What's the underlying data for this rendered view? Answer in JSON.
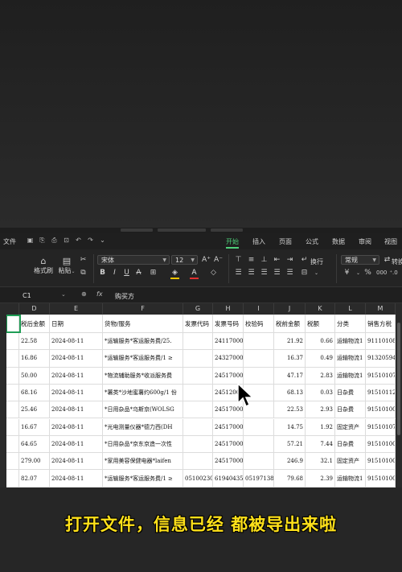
{
  "menu": {
    "file": "文件",
    "tabs": [
      "开始",
      "插入",
      "页面",
      "公式",
      "数据",
      "审阅",
      "视图"
    ],
    "active_tab": "开始"
  },
  "ribbon": {
    "format_painter": "格式刷",
    "paste": "粘贴",
    "font_name": "宋体",
    "font_size": "12",
    "wrap": "换行",
    "number_format": "常规",
    "convert": "转换"
  },
  "formula_bar": {
    "cell_ref": "C1",
    "fx": "fx",
    "content": "购买方"
  },
  "columns": [
    "D",
    "E",
    "F",
    "G",
    "H",
    "I",
    "J",
    "K",
    "L",
    "M"
  ],
  "header_row": [
    "税后金额",
    "日期",
    "货物/服务",
    "发票代码",
    "发票号码",
    "校验码",
    "税前金额",
    "税额",
    "分类",
    "销售方税"
  ],
  "rows": [
    [
      "22.58",
      "2024-08-11",
      "*运输服务*客运服务费/25.",
      "",
      "241170000",
      "",
      "21.92",
      "0.66",
      "运输物流1",
      "91110108M"
    ],
    [
      "16.86",
      "2024-08-11",
      "*运输服务*客运服务费/1 ≥",
      "",
      "243270000",
      "",
      "16.37",
      "0.49",
      "运输物流1",
      "91320594M"
    ],
    [
      "50.00",
      "2024-08-11",
      "*物流辅助服务*收派服务费",
      "",
      "245170000",
      "",
      "47.17",
      "2.83",
      "运输物流1",
      "91510107"
    ],
    [
      "68.16",
      "2024-08-11",
      "*薯类*沙地蜜薯约600g/1 份",
      "",
      "2451200",
      "",
      "68.13",
      "0.03",
      "日杂费",
      "91510112M"
    ],
    [
      "25.46",
      "2024-08-11",
      "*日用杂品*乌斯京(WOLSG",
      "",
      "245170000",
      "",
      "22.53",
      "2.93",
      "日杂费",
      "91510100M"
    ],
    [
      "16.67",
      "2024-08-11",
      "*光电测量仪器*德力西(DH",
      "",
      "245170000",
      "",
      "14.75",
      "1.92",
      "固定资产",
      "91510107"
    ],
    [
      "64.65",
      "2024-08-11",
      "*日用杂品*京东京造一次性",
      "",
      "245170000",
      "",
      "57.21",
      "7.44",
      "日杂费",
      "91510100M"
    ],
    [
      "279.00",
      "2024-08-11",
      "*家用美容保健电器*laifen",
      "",
      "245170000",
      "",
      "246.9",
      "32.1",
      "固定资产",
      "91510100M"
    ],
    [
      "82.07",
      "2024-08-11",
      "*运输服务*客运服务费/1 ≥",
      "051002300",
      "61940435",
      "051971388",
      "79.68",
      "2.39",
      "运输物流1",
      "91510100M"
    ]
  ],
  "caption": "打开文件，信息已经 都被导出来啦"
}
